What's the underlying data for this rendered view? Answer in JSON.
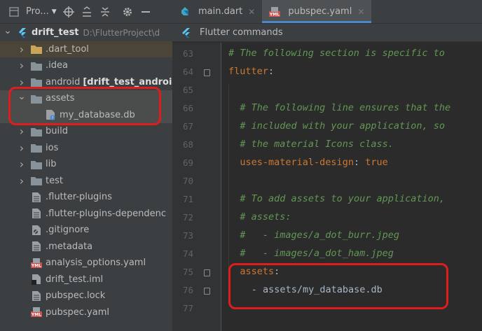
{
  "project_panel": {
    "selector_label": "Pro...",
    "tree": [
      {
        "label": "drift_test",
        "sub": "D:\\FlutterProject\\d",
        "bold": true,
        "expanded": true,
        "level": 0,
        "icon": "module-icon"
      },
      {
        "label": ".dart_tool",
        "level": 1,
        "icon": "folder-icon",
        "collapsed": true
      },
      {
        "label": ".idea",
        "level": 1,
        "icon": "folder-icon",
        "collapsed": true
      },
      {
        "label": "android",
        "module": "[drift_test_android",
        "level": 1,
        "icon": "folder-icon",
        "collapsed": true
      },
      {
        "label": "assets",
        "level": 1,
        "icon": "folder-icon",
        "expanded": true
      },
      {
        "label": "my_database.db",
        "level": 2,
        "icon": "db-file-icon"
      },
      {
        "label": "build",
        "level": 1,
        "icon": "folder-icon",
        "collapsed": true
      },
      {
        "label": "ios",
        "level": 1,
        "icon": "folder-icon",
        "collapsed": true
      },
      {
        "label": "lib",
        "level": 1,
        "icon": "folder-icon",
        "collapsed": true
      },
      {
        "label": "test",
        "level": 1,
        "icon": "folder-icon",
        "collapsed": true
      },
      {
        "label": ".flutter-plugins",
        "level": 1,
        "icon": "file-icon"
      },
      {
        "label": ".flutter-plugins-dependenc",
        "level": 1,
        "icon": "file-icon"
      },
      {
        "label": ".gitignore",
        "level": 1,
        "icon": "gitignore-icon"
      },
      {
        "label": ".metadata",
        "level": 1,
        "icon": "file-icon"
      },
      {
        "label": "analysis_options.yaml",
        "level": 1,
        "icon": "yaml-icon"
      },
      {
        "label": "drift_test.iml",
        "level": 1,
        "icon": "iml-icon"
      },
      {
        "label": "pubspec.lock",
        "level": 1,
        "icon": "file-icon"
      },
      {
        "label": "pubspec.yaml",
        "level": 1,
        "icon": "yaml-icon"
      }
    ]
  },
  "editor": {
    "tabs": [
      {
        "label": "main.dart",
        "icon": "dart-icon",
        "active": false
      },
      {
        "label": "pubspec.yaml",
        "icon": "yaml-icon",
        "active": true
      }
    ],
    "commands_label": "Flutter commands",
    "lines": [
      {
        "num": "63",
        "text": "# The following section is specific to",
        "type": "comment",
        "indent": 0
      },
      {
        "num": "64",
        "text": "flutter",
        "type": "key",
        "indent": 0
      },
      {
        "num": "65",
        "text": "",
        "type": "blank",
        "indent": 0
      },
      {
        "num": "66",
        "text": "# The following line ensures that the",
        "type": "comment",
        "indent": 2
      },
      {
        "num": "67",
        "text": "# included with your application, so",
        "type": "comment",
        "indent": 2
      },
      {
        "num": "68",
        "text": "# the material Icons class.",
        "type": "comment",
        "indent": 2
      },
      {
        "num": "69",
        "text": "uses-material-design",
        "value": "true",
        "type": "keyvalue",
        "indent": 2
      },
      {
        "num": "70",
        "text": "",
        "type": "blank",
        "indent": 0
      },
      {
        "num": "71",
        "text": "# To add assets to your application,",
        "type": "comment",
        "indent": 2
      },
      {
        "num": "72",
        "text": "# assets:",
        "type": "comment",
        "indent": 2
      },
      {
        "num": "73",
        "text": "#   - images/a_dot_burr.jpeg",
        "type": "comment",
        "indent": 2
      },
      {
        "num": "74",
        "text": "#   - images/a_dot_ham.jpeg",
        "type": "comment",
        "indent": 2
      },
      {
        "num": "75",
        "text": "assets",
        "type": "key",
        "indent": 2
      },
      {
        "num": "76",
        "text": "- assets/my_database.db",
        "type": "plain",
        "indent": 4
      },
      {
        "num": "77",
        "text": "",
        "type": "blank",
        "indent": 0
      }
    ]
  },
  "colors": {
    "highlight_box": "#e01d1d",
    "comment": "#629755",
    "key": "#cc7832",
    "accent_tab": "#4a88c7"
  }
}
